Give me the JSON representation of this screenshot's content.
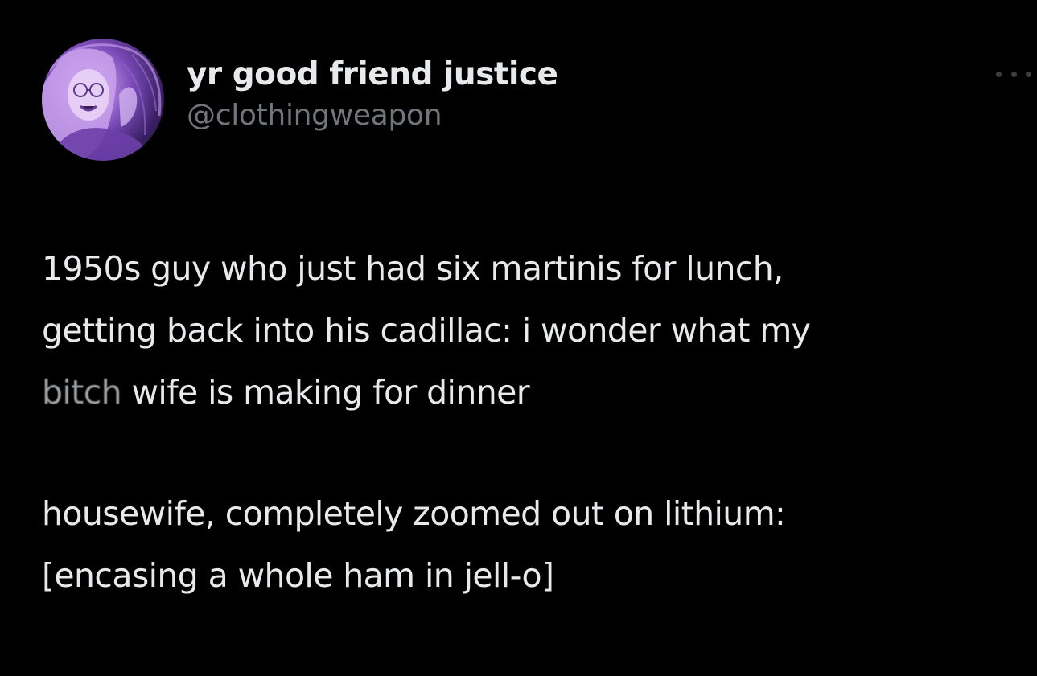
{
  "author": {
    "display_name": "yr good friend justice",
    "handle": "@clothingweapon",
    "avatar_icon": "profile-photo"
  },
  "menu": {
    "icon": "more-options-icon"
  },
  "tweet": {
    "para1": {
      "line1": "1950s guy who just had six martinis for lunch,",
      "line2": "getting back into his cadillac: i wonder what my",
      "line3_obscured": "bitch",
      "line3_rest": " wife is making for dinner"
    },
    "para2": {
      "line1": "housewife, completely zoomed out on lithium:",
      "line2": "[encasing a whole ham in jell-o]"
    }
  },
  "colors": {
    "background": "#000000",
    "text": "#e7e9ea",
    "secondary": "#71767b",
    "avatar_accent": "#b889e0"
  }
}
